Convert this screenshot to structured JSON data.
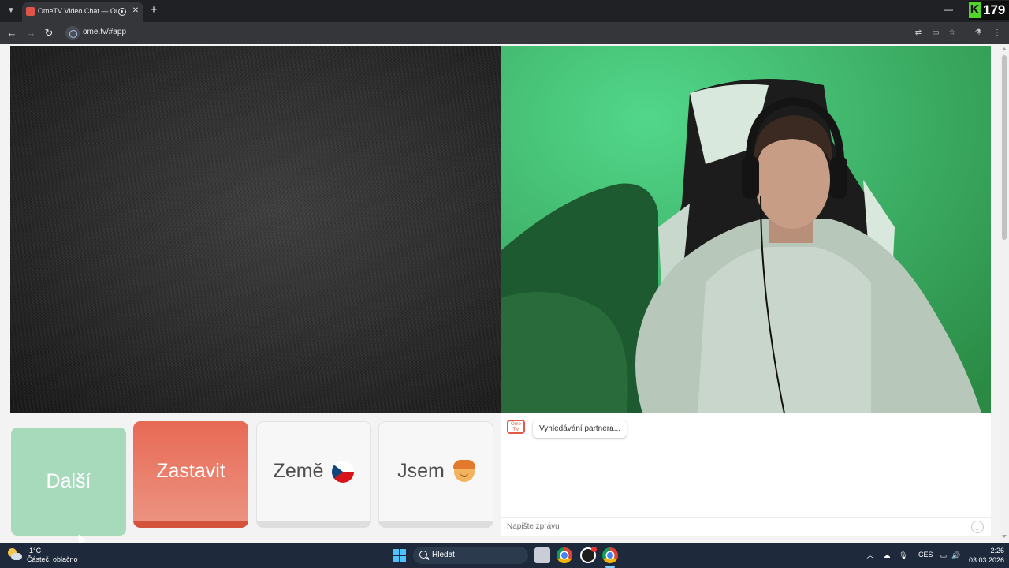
{
  "browser": {
    "tab_title": "OmeTV Video Chat — Omegle",
    "url": "ome.tv/#app",
    "badge_letter": "K",
    "badge_count": "179"
  },
  "app": {
    "buttons": {
      "next": "Další",
      "stop": "Zastavit",
      "country": "Země",
      "gender": "Jsem"
    },
    "chat": {
      "logo_text": "Ome TV",
      "status_message": "Vyhledávání partnera...",
      "input_placeholder": "Napište zprávu"
    },
    "colors": {
      "next_button": "#a7d9bb",
      "stop_button": "#e76a55",
      "local_video_tint": "#2f8a45"
    }
  },
  "taskbar": {
    "weather_temp": "-1°C",
    "weather_condition": "Částeč. oblačno",
    "search_label": "Hledat",
    "language": "CES",
    "time": "2:26",
    "date": "03.03.2026"
  }
}
